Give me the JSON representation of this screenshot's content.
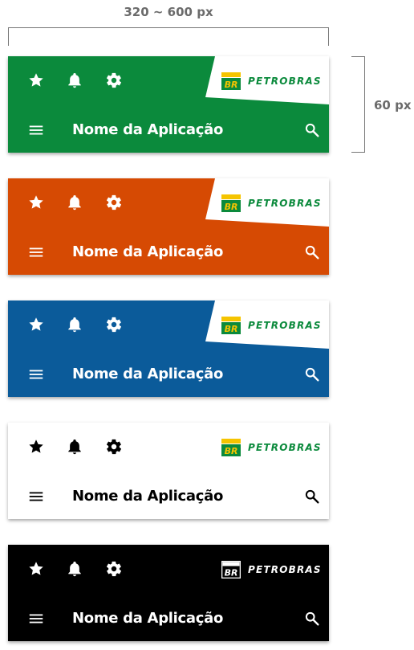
{
  "annotations": {
    "width_label": "320 ~ 600 px",
    "height_label": "60 px"
  },
  "bars": [
    {
      "variant": "green",
      "background": "#0b8a3c",
      "foreground": "#ffffff",
      "logo_panel": "#ffffff",
      "logo_style": "color",
      "title": "Nome da Aplicação",
      "brand": "PETROBRAS",
      "logo_mark": "BR"
    },
    {
      "variant": "orange",
      "background": "#d64a03",
      "foreground": "#ffffff",
      "logo_panel": "#ffffff",
      "logo_style": "color",
      "title": "Nome da Aplicação",
      "brand": "PETROBRAS",
      "logo_mark": "BR"
    },
    {
      "variant": "blue",
      "background": "#0b5b9a",
      "foreground": "#ffffff",
      "logo_panel": "#ffffff",
      "logo_style": "color",
      "title": "Nome da Aplicação",
      "brand": "PETROBRAS",
      "logo_mark": "BR"
    },
    {
      "variant": "white",
      "background": "#ffffff",
      "foreground": "#000000",
      "logo_panel": "#ffffff",
      "logo_style": "color",
      "title": "Nome da Aplicação",
      "brand": "PETROBRAS",
      "logo_mark": "BR"
    },
    {
      "variant": "black",
      "background": "#000000",
      "foreground": "#ffffff",
      "logo_panel": "#000000",
      "logo_style": "mono",
      "title": "Nome da Aplicação",
      "brand": "PETROBRAS",
      "logo_mark": "BR"
    }
  ],
  "icons": {
    "top_left": [
      "star-icon",
      "bell-icon",
      "gear-icon"
    ],
    "bottom_left": "menu-icon",
    "bottom_right": "search-icon"
  },
  "brand_colors": {
    "green": "#0b8a3c",
    "yellow": "#f5c400"
  }
}
